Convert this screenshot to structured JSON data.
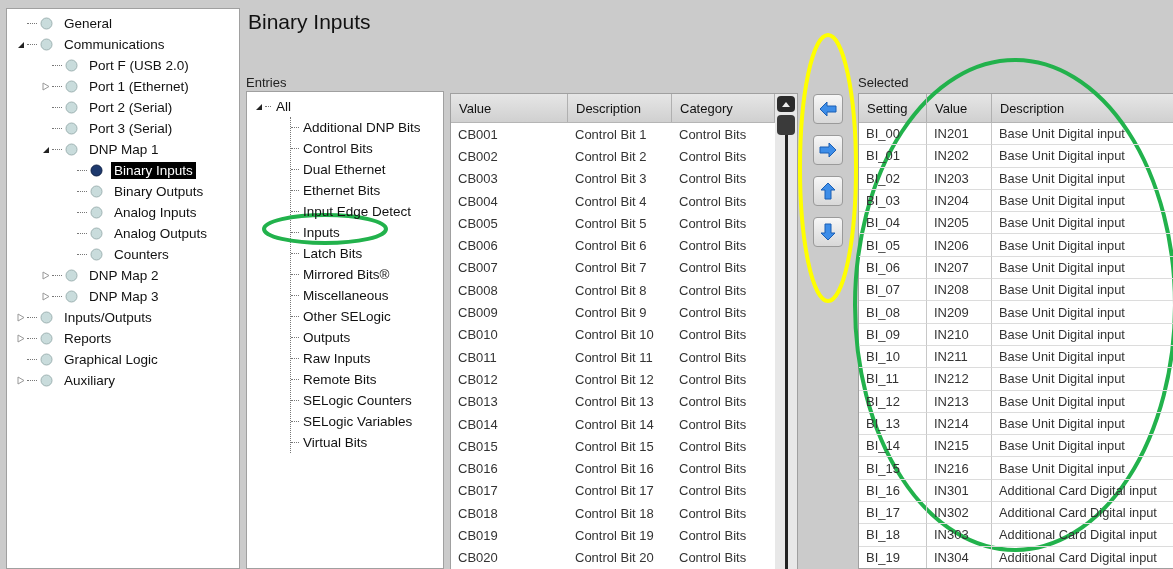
{
  "nav_tree": [
    {
      "label": "General",
      "selected": false
    },
    {
      "label": "Communications",
      "selected": false,
      "expanded": true,
      "children": [
        {
          "label": "Port F (USB 2.0)",
          "selected": false
        },
        {
          "label": "Port 1 (Ethernet)",
          "selected": false,
          "expanded": false
        },
        {
          "label": "Port 2 (Serial)",
          "selected": false
        },
        {
          "label": "Port 3 (Serial)",
          "selected": false
        },
        {
          "label": "DNP Map 1",
          "selected": false,
          "expanded": true,
          "children": [
            {
              "label": "Binary Inputs",
              "selected": true
            },
            {
              "label": "Binary Outputs",
              "selected": false
            },
            {
              "label": "Analog Inputs",
              "selected": false
            },
            {
              "label": "Analog Outputs",
              "selected": false
            },
            {
              "label": "Counters",
              "selected": false
            }
          ]
        },
        {
          "label": "DNP Map 2",
          "selected": false,
          "expanded": false
        },
        {
          "label": "DNP Map 3",
          "selected": false,
          "expanded": false
        }
      ]
    },
    {
      "label": "Inputs/Outputs",
      "selected": false,
      "expanded": false
    },
    {
      "label": "Reports",
      "selected": false,
      "expanded": false
    },
    {
      "label": "Graphical Logic",
      "selected": false
    },
    {
      "label": "Auxiliary",
      "selected": false,
      "expanded": false
    }
  ],
  "page_title": "Binary Inputs",
  "entries": {
    "label": "Entries",
    "tree": {
      "label": "All",
      "expanded": true,
      "children": [
        "Additional DNP Bits",
        "Control Bits",
        "Dual Ethernet",
        "Ethernet Bits",
        "Input Edge Detect",
        "Inputs",
        "Latch Bits",
        "Mirrored Bits®",
        "Miscellaneous",
        "Other SELogic",
        "Outputs",
        "Raw Inputs",
        "Remote Bits",
        "SELogic Counters",
        "SELogic Variables",
        "Virtual Bits"
      ]
    },
    "table": {
      "columns": [
        "Value",
        "Description",
        "Category"
      ],
      "rows": [
        [
          "CB001",
          "Control Bit 1",
          "Control Bits"
        ],
        [
          "CB002",
          "Control Bit 2",
          "Control Bits"
        ],
        [
          "CB003",
          "Control Bit 3",
          "Control Bits"
        ],
        [
          "CB004",
          "Control Bit 4",
          "Control Bits"
        ],
        [
          "CB005",
          "Control Bit 5",
          "Control Bits"
        ],
        [
          "CB006",
          "Control Bit 6",
          "Control Bits"
        ],
        [
          "CB007",
          "Control Bit 7",
          "Control Bits"
        ],
        [
          "CB008",
          "Control Bit 8",
          "Control Bits"
        ],
        [
          "CB009",
          "Control Bit 9",
          "Control Bits"
        ],
        [
          "CB010",
          "Control Bit 10",
          "Control Bits"
        ],
        [
          "CB011",
          "Control Bit 11",
          "Control Bits"
        ],
        [
          "CB012",
          "Control Bit 12",
          "Control Bits"
        ],
        [
          "CB013",
          "Control Bit 13",
          "Control Bits"
        ],
        [
          "CB014",
          "Control Bit 14",
          "Control Bits"
        ],
        [
          "CB015",
          "Control Bit 15",
          "Control Bits"
        ],
        [
          "CB016",
          "Control Bit 16",
          "Control Bits"
        ],
        [
          "CB017",
          "Control Bit 17",
          "Control Bits"
        ],
        [
          "CB018",
          "Control Bit 18",
          "Control Bits"
        ],
        [
          "CB019",
          "Control Bit 19",
          "Control Bits"
        ],
        [
          "CB020",
          "Control Bit 20",
          "Control Bits"
        ]
      ]
    }
  },
  "move_buttons": [
    {
      "kind": "left"
    },
    {
      "kind": "right"
    },
    {
      "kind": "up"
    },
    {
      "kind": "down"
    }
  ],
  "selected": {
    "label": "Selected",
    "table": {
      "columns": [
        "Setting",
        "Value",
        "Description"
      ],
      "rows": [
        [
          "BI_00",
          "IN201",
          "Base Unit Digital input"
        ],
        [
          "BI_01",
          "IN202",
          "Base Unit Digital input"
        ],
        [
          "BI_02",
          "IN203",
          "Base Unit Digital input"
        ],
        [
          "BI_03",
          "IN204",
          "Base Unit Digital input"
        ],
        [
          "BI_04",
          "IN205",
          "Base Unit Digital input"
        ],
        [
          "BI_05",
          "IN206",
          "Base Unit Digital input"
        ],
        [
          "BI_06",
          "IN207",
          "Base Unit Digital input"
        ],
        [
          "BI_07",
          "IN208",
          "Base Unit Digital input"
        ],
        [
          "BI_08",
          "IN209",
          "Base Unit Digital input"
        ],
        [
          "BI_09",
          "IN210",
          "Base Unit Digital input"
        ],
        [
          "BI_10",
          "IN211",
          "Base Unit Digital input"
        ],
        [
          "BI_11",
          "IN212",
          "Base Unit Digital input"
        ],
        [
          "BI_12",
          "IN213",
          "Base Unit Digital input"
        ],
        [
          "BI_13",
          "IN214",
          "Base Unit Digital input"
        ],
        [
          "BI_14",
          "IN215",
          "Base Unit Digital input"
        ],
        [
          "BI_15",
          "IN216",
          "Base Unit Digital input"
        ],
        [
          "BI_16",
          "IN301",
          "Additional Card Digital input"
        ],
        [
          "BI_17",
          "IN302",
          "Additional Card Digital input"
        ],
        [
          "BI_18",
          "IN303",
          "Additional Card Digital input"
        ],
        [
          "BI_19",
          "IN304",
          "Additional Card Digital input"
        ]
      ]
    }
  },
  "annotations": [
    {
      "kind": "ellipse",
      "color": "#22b24c"
    },
    {
      "kind": "ellipse",
      "color": "#ffff00"
    },
    {
      "kind": "ellipse",
      "color": "#22b24c"
    }
  ]
}
